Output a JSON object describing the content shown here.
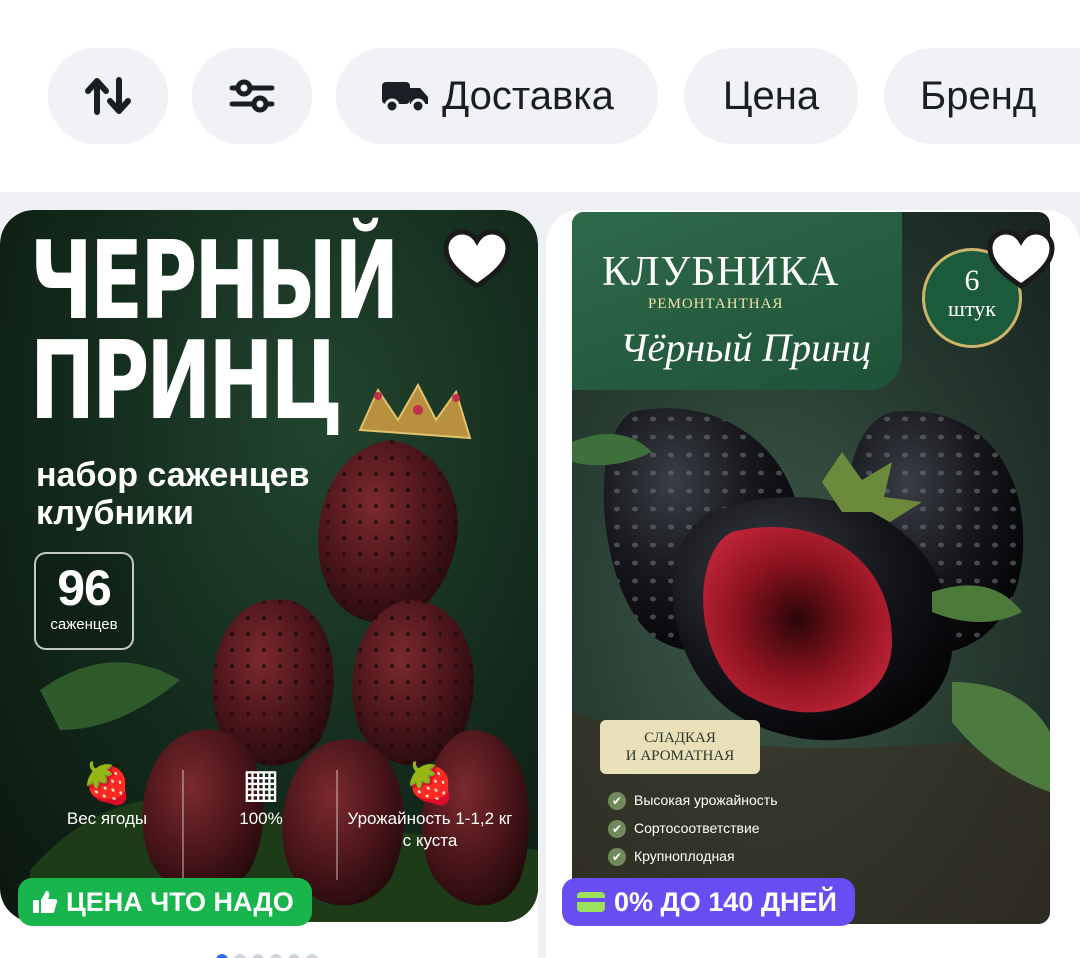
{
  "filters": {
    "sort_icon": "sort-arrows-icon",
    "filter_icon": "sliders-icon",
    "delivery_icon": "truck-icon",
    "delivery_label": "Доставка",
    "price_label": "Цена",
    "brand_label": "Бренд"
  },
  "products": [
    {
      "art": {
        "title_line1": "ЧЕРНЫЙ",
        "title_line2": "ПРИНЦ",
        "subtitle_line1": "набор саженцев",
        "subtitle_line2": "клубники",
        "count": "96",
        "count_label": "саженцев",
        "features": [
          {
            "icon": "strawberry-icon",
            "text": "Вес ягоды"
          },
          {
            "icon": "crate-icon",
            "text": "100%"
          },
          {
            "icon": "berries-icon",
            "text": "Урожайность 1-1,2 кг с куста"
          }
        ]
      },
      "promo": {
        "icon": "thumbs-up-icon",
        "text": "ЦЕНА ЧТО НАДО",
        "color": "#17b54b"
      },
      "gallery": {
        "count": 6,
        "active": 0
      }
    },
    {
      "art": {
        "title": "КЛУБНИКА",
        "subtitle": "РЕМОНТАНТНАЯ",
        "script": "Чёрный Принц",
        "badge_count": "6",
        "badge_unit": "штук",
        "label_line1": "СЛАДКАЯ",
        "label_line2": "И АРОМАТНАЯ",
        "list": [
          "Высокая урожайность",
          "Сортосоответствие",
          "Крупноплодная"
        ]
      },
      "promo": {
        "icon": "card-icon",
        "text": "0% ДО 140 ДНЕЙ",
        "color": "#6a4cf3"
      }
    }
  ]
}
